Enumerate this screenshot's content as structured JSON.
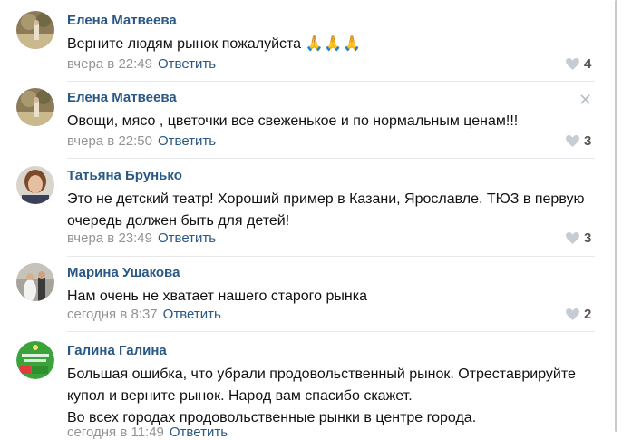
{
  "comments": [
    {
      "author": "Елена Матвеева",
      "lines": [
        "Верните людям рынок пожалуйста"
      ],
      "emoji": "🙏🙏🙏",
      "date": "вчера в 22:49",
      "reply": "Ответить",
      "likes": "4"
    },
    {
      "author": "Елена Матвеева",
      "lines": [
        "Овощи, мясо , цветочки все свеженькое и по нормальным ценам!!!"
      ],
      "date": "вчера в 22:50",
      "reply": "Ответить",
      "likes": "3"
    },
    {
      "author": "Татьяна Брунько",
      "lines": [
        "Это не детский театр! Хороший пример в Казани, Ярославле. ТЮЗ в первую",
        "очередь должен быть для детей!"
      ],
      "date": "вчера в 23:49",
      "reply": "Ответить",
      "likes": "3"
    },
    {
      "author": "Марина Ушакова",
      "lines": [
        "Нам очень не хватает нашего старого рынка"
      ],
      "date": "сегодня в 8:37",
      "reply": "Ответить",
      "likes": "2"
    },
    {
      "author": "Галина Галина",
      "lines": [
        "Большая ошибка, что убрали продовольственный рынок. Отреставрируйте",
        "купол и верните рынок. Народ вам спасибо скажет.",
        "Во всех городах продовольственные рынки в центре города."
      ],
      "date": "сегодня в 11:49",
      "reply": "Ответить"
    }
  ],
  "icons": {
    "like": "heart-icon",
    "delete": "close-icon"
  },
  "colors": {
    "author": "#2a5885",
    "meta": "#939393",
    "like_icon": "#c5ccd4"
  }
}
